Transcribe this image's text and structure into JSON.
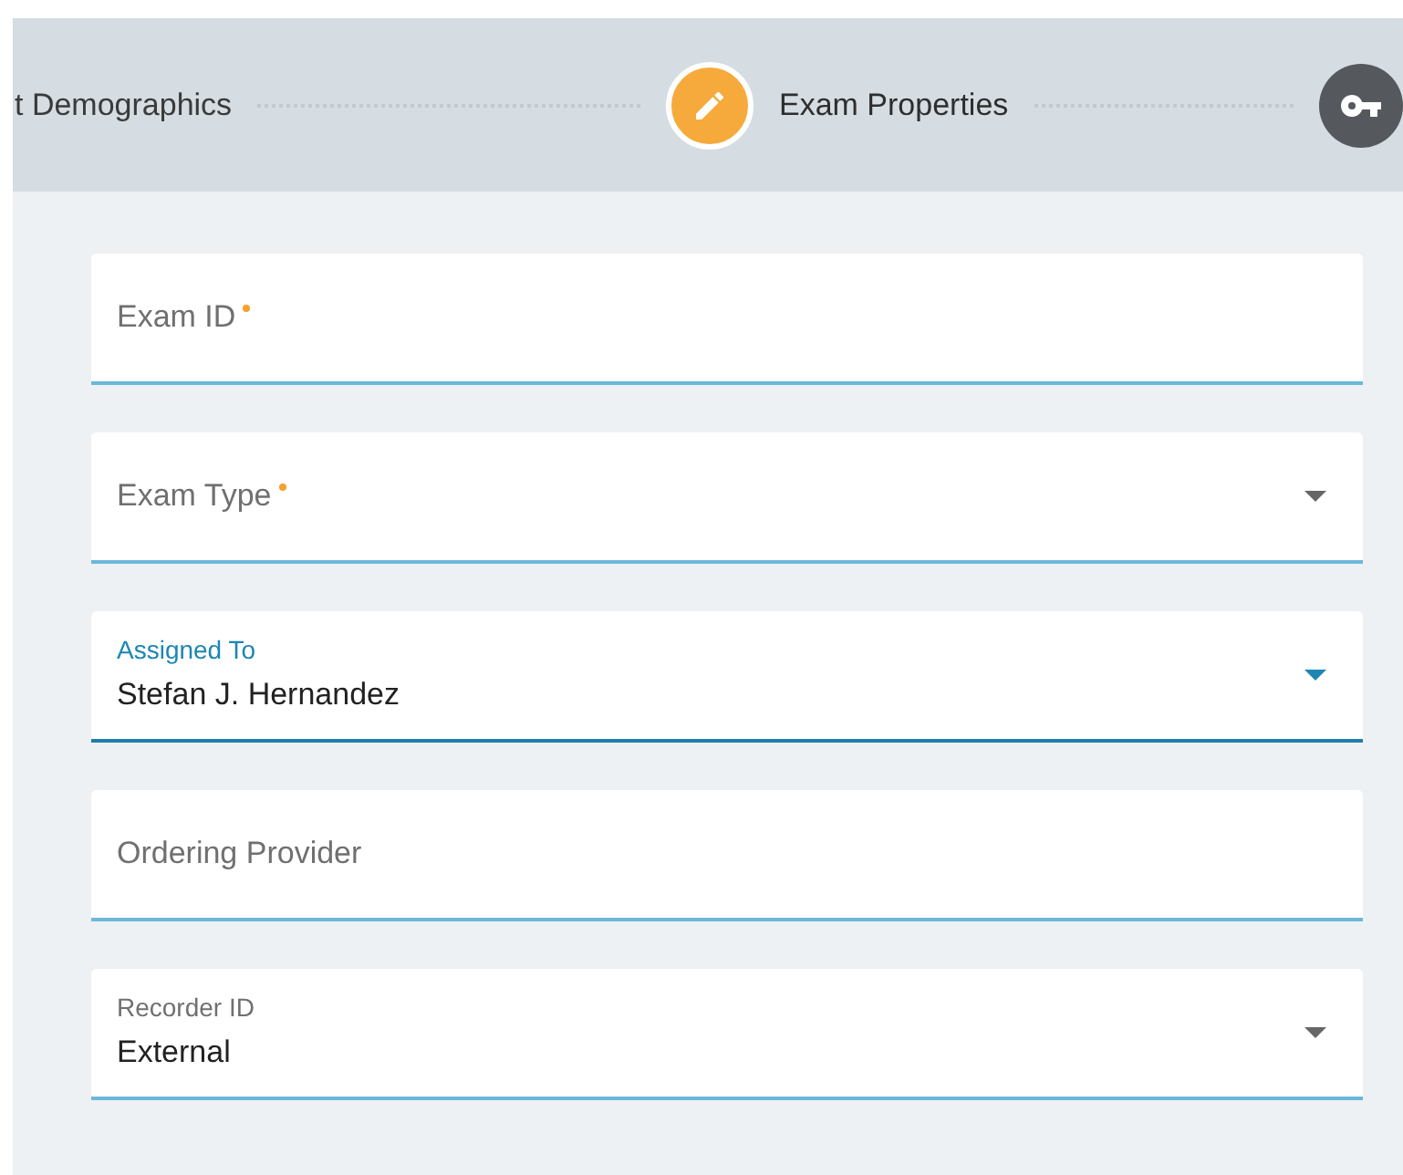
{
  "stepper": {
    "steps": [
      {
        "kind": "text",
        "label": "t Demographics",
        "selected": false
      },
      {
        "kind": "edit",
        "label": "Exam Properties",
        "selected": true
      },
      {
        "kind": "locked",
        "selected": false
      }
    ]
  },
  "fields": [
    {
      "kind": "text",
      "label": "Exam ID",
      "required": true,
      "focused": false
    },
    {
      "kind": "select",
      "label": "Exam Type",
      "required": true,
      "focused": false
    },
    {
      "kind": "select",
      "label": "Assigned To",
      "value": "Stefan J. Hernandez",
      "required": false,
      "focused": true
    },
    {
      "kind": "text",
      "label": "Ordering Provider",
      "required": false,
      "focused": false
    },
    {
      "kind": "select",
      "label": "Recorder ID",
      "value": "External",
      "required": false,
      "focused": false
    }
  ]
}
